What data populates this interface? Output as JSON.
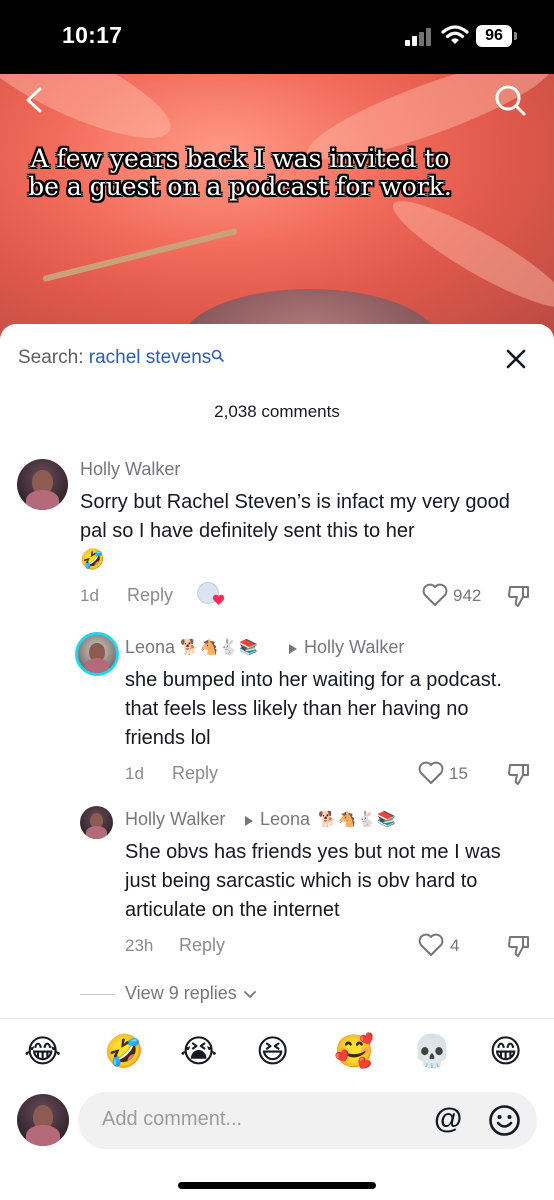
{
  "status_bar": {
    "time": "10:17",
    "battery": "96"
  },
  "video": {
    "caption": "A few years back I was invited to be a guest on a podcast for work."
  },
  "sheet": {
    "search_prefix": "Search:",
    "search_query": "rachel stevens",
    "comment_count": "2,038 comments"
  },
  "comments": [
    {
      "author": "Holly Walker",
      "text": "Sorry but Rachel Steven’s is infact my very good pal so I have definitely sent this to her",
      "emoji": "🤣",
      "time": "1d",
      "reply_label": "Reply",
      "likes": "942"
    }
  ],
  "replies": [
    {
      "author": "Leona",
      "author_emoji": "🐕🐴🐇📚",
      "reply_to": "Holly Walker",
      "text": "she bumped into her waiting for a podcast. that feels less likely than her having no friends lol",
      "time": "1d",
      "reply_label": "Reply",
      "likes": "15"
    },
    {
      "author": "Holly Walker",
      "reply_to": "Leona",
      "reply_to_emoji": "🐕🐴🐇📚",
      "text": "She obvs has friends yes but not me I was just being sarcastic which is obv hard to articulate on the internet",
      "time": "23h",
      "reply_label": "Reply",
      "likes": "4"
    }
  ],
  "view_more": "View 9 replies",
  "emoji_bar": [
    "😂",
    "🤣",
    "😭",
    "😆",
    "🥰",
    "💀",
    "😁"
  ],
  "composer": {
    "placeholder": "Add comment...",
    "at_symbol": "@"
  },
  "icons": [
    "back-icon",
    "search-icon",
    "close-icon",
    "heart-icon",
    "dislike-icon",
    "chevron-down-icon",
    "smiley-icon",
    "triangle-right-icon"
  ]
}
